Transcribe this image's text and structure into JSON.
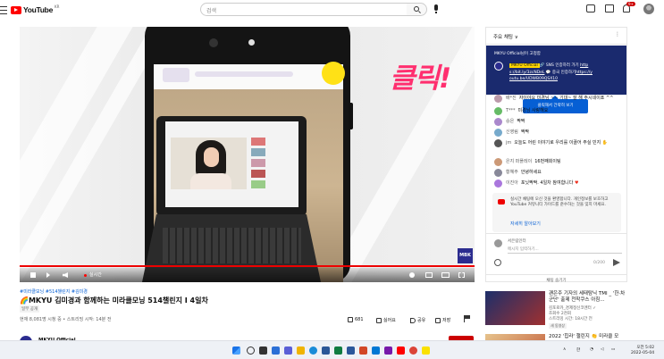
{
  "header": {
    "logo_text": "YouTube",
    "logo_region": "KR",
    "search_placeholder": "검색",
    "notification_count": "9+"
  },
  "player": {
    "overlay_text": "클릭!",
    "live_label": "실시간",
    "watermark": "MBK"
  },
  "video": {
    "hashtags": "#미라클모닝 #514챌린지 #김미경",
    "title": "🌈MKYU 김미경과 함께하는 미라클모닝 514챌린지 I 4일차",
    "visibility": "일부 공개",
    "meta": "현재 8,081명 시청 중 • 스트리밍 시작: 14분 전",
    "likes": "681",
    "dislike_label": "싫어요",
    "share_label": "공유",
    "save_label": "저장",
    "channel_name": "MKYU Official"
  },
  "chat": {
    "title": "주요 채팅 ∨",
    "more": "⋮",
    "pinned_header": "MKYU Official님이 고정함",
    "pinned_author": "MKYU Official",
    "pinned_text": "🔗 SNS 인증하러 가기 ",
    "pinned_link1": "http s://bit.ly/3zcNDeL",
    "pinned_text2": " 💬 중국 인증하기",
    "pinned_link2": "https://y outu.be/UDWB09QSX10",
    "tooltip": "클릭해서 간략히 보기",
    "messages": [
      {
        "name": "배*진",
        "text": "자이야요 미경님 ~~ 기대~ 잘 해 주시네이죠 ^^"
      },
      {
        "name": "T***",
        "text": "미경님 사랑해요"
      },
      {
        "name": "승은",
        "text": "짝짝"
      },
      {
        "name": "신영림",
        "text": "짝짝"
      },
      {
        "name": "jm",
        "text": "오늘도 어린 이야기로 우리를 이끌어 주실 민지 ✋"
      },
      {
        "name": "은지 퍼플레이",
        "text": "16번째회이팅"
      },
      {
        "name": "황혜주",
        "text": "안녕하세요"
      },
      {
        "name": "이진아",
        "text": "포닛짝짝. 4일차 참여합니다"
      }
    ],
    "system_text": "실시간 채팅에 오신 것을 환영합니다. 개인정보를 보호하고 YouTube 커뮤니티 가이드를 준수하는 것을 잊지 마세요.",
    "system_link": "자세히 알아보기",
    "input_user": "서은림인터",
    "input_placeholder": "메시지 입력하기...",
    "char_count": "0/200",
    "hide_label": "채팅 숨기기"
  },
  "recommendations": [
    {
      "title": "괜은주 기자의 세태탐닉 TMI _ '한·차 군단' 출제 천착쿠스 아침...",
      "channel": "김포로카_경제정신코멘터 ✓",
      "views": "조회수 2천회",
      "time": "스트리밍 시간: 18시간 전",
      "badge": "새 동영상"
    },
    {
      "title": "2022 '힙라' 챌린지 👏 미라클 모",
      "channel": "",
      "views": "",
      "time": "",
      "badge": ""
    }
  ],
  "taskbar": {
    "tray_lang": "한",
    "time": "오전 5:02",
    "date": "2022-05-04"
  }
}
